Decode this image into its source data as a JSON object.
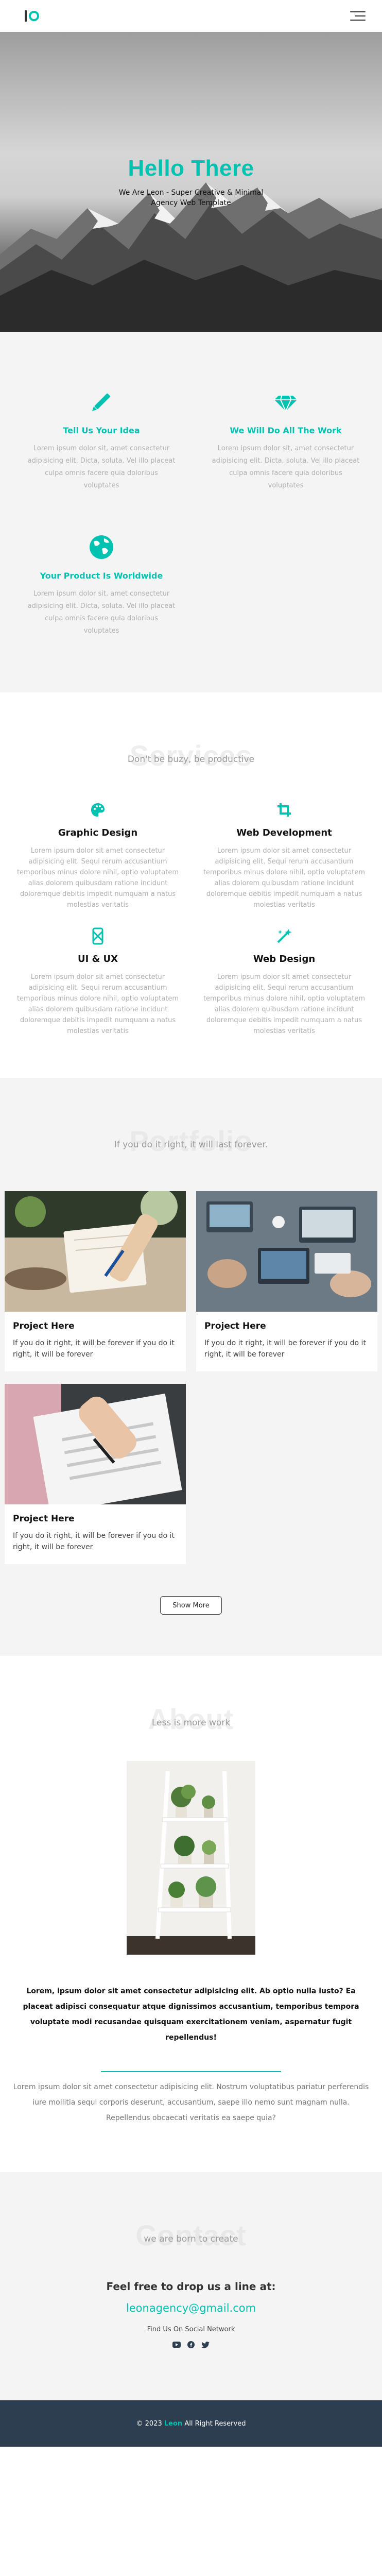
{
  "colors": {
    "accent": "#00c2b1",
    "footer_bg": "#2d3e50",
    "section_bg": "#f4f4f4"
  },
  "nav": {
    "logo_icon": "leon-logo",
    "menu_icon": "hamburger-icon"
  },
  "hero": {
    "title": "Hello There",
    "subtitle": "We Are Leon - Super Creative & Minimal Agency Web Template"
  },
  "features": [
    {
      "icon": "pencil-icon",
      "title": "Tell Us Your Idea",
      "text": "Lorem ipsum dolor sit, amet consectetur adipisicing elit. Dicta, soluta. Vel illo placeat culpa omnis facere quia doloribus voluptates"
    },
    {
      "icon": "diamond-icon",
      "title": "We Will Do All The Work",
      "text": "Lorem ipsum dolor sit, amet consectetur adipisicing elit. Dicta, soluta. Vel illo placeat culpa omnis facere quia doloribus voluptates"
    },
    {
      "icon": "globe-icon",
      "title": "Your Product Is Worldwide",
      "text": "Lorem ipsum dolor sit, amet consectetur adipisicing elit. Dicta, soluta. Vel illo placeat culpa omnis facere quia doloribus voluptates"
    }
  ],
  "services": {
    "bg_title": "Services",
    "subtitle": "Don't be buzy, be productive",
    "items": [
      {
        "icon": "palette-icon",
        "title": "Graphic Design",
        "text": "Lorem ipsum dolor sit amet consectetur adipisicing elit. Sequi rerum accusantium temporibus minus dolore nihil, optio voluptatem alias dolorem quibusdam ratione incidunt doloremque debitis impedit numquam a natus molestias veritatis"
      },
      {
        "icon": "crop-icon",
        "title": "Web Development",
        "text": "Lorem ipsum dolor sit amet consectetur adipisicing elit. Sequi rerum accusantium temporibus minus dolore nihil, optio voluptatem alias dolorem quibusdam ratione incidunt doloremque debitis impedit numquam a natus molestias veritatis"
      },
      {
        "icon": "phone-icon",
        "title": "UI & UX",
        "text": "Lorem ipsum dolor sit amet consectetur adipisicing elit. Sequi rerum accusantium temporibus minus dolore nihil, optio voluptatem alias dolorem quibusdam ratione incidunt doloremque debitis impedit numquam a natus molestias veritatis"
      },
      {
        "icon": "magic-wand-icon",
        "title": "Web Design",
        "text": "Lorem ipsum dolor sit amet consectetur adipisicing elit. Sequi rerum accusantium temporibus minus dolore nihil, optio voluptatem alias dolorem quibusdam ratione incidunt doloremque debitis impedit numquam a natus molestias veritatis"
      }
    ]
  },
  "portfolio": {
    "bg_title": "Portfolio",
    "subtitle": "If you do it right, it will last forever.",
    "items": [
      {
        "image": "notebook-writing",
        "title": "Project Here",
        "text": "If you do it right, it will be forever if you do it right, it will be forever"
      },
      {
        "image": "team-laptops",
        "title": "Project Here",
        "text": "If you do it right, it will be forever if you do it right, it will be forever"
      },
      {
        "image": "survey-form",
        "title": "Project Here",
        "text": "If you do it right, it will be forever if you do it right, it will be forever"
      }
    ],
    "show_more": "Show More"
  },
  "about": {
    "bg_title": "About",
    "subtitle": "Less is more work",
    "image": "plant-shelf",
    "lead": "Lorem, ipsum dolor sit amet consectetur adipisicing elit. Ab optio nulla iusto? Ea placeat adipisci consequatur atque dignissimos accusantium, temporibus tempora voluptate modi recusandae quisquam exercitationem veniam, aspernatur fugit repellendus!",
    "body": "Lorem ipsum dolor sit amet consectetur adipisicing elit. Nostrum voluptatibus pariatur perferendis iure mollitia sequi corporis deserunt, accusantium, saepe illo nemo sunt magnam nulla. Repellendus obcaecati veritatis ea saepe quia?"
  },
  "contact": {
    "bg_title": "Contact",
    "subtitle": "we are born to create",
    "heading": "Feel free to drop us a line at:",
    "email": "leonagency@gmail.com",
    "social_label": "Find Us On Social Network",
    "socials": [
      "youtube-icon",
      "facebook-icon",
      "twitter-icon"
    ]
  },
  "footer": {
    "prefix": "© 2023",
    "brand": "Leon",
    "suffix": "All Right Reserved"
  }
}
